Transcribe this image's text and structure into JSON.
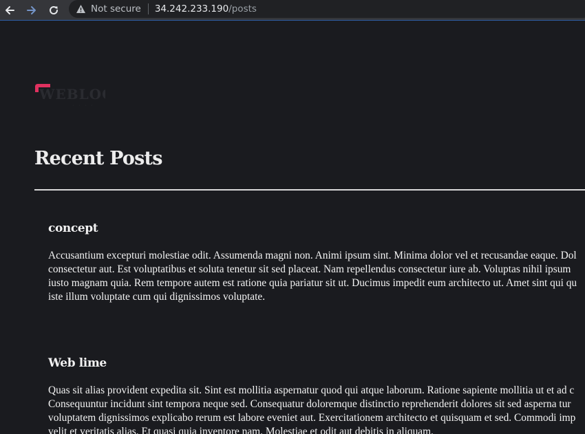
{
  "browser": {
    "security_label": "Not secure",
    "url_host": "34.242.233.190",
    "url_path": "/posts",
    "accent_color": "#2f5fa8"
  },
  "page": {
    "title": "Recent Posts",
    "logo_text": "WEBLOG",
    "logo_accent_color": "#e0315f",
    "background_color": "#1a1b1f"
  },
  "posts": [
    {
      "title": "concept",
      "body_lines": [
        "Accusantium excepturi molestiae odit. Assumenda magni non. Animi ipsum sint. Minima dolor vel et recusandae eaque. Dol",
        "consectetur aut. Est voluptatibus et soluta tenetur sit sed placeat. Nam repellendus consectetur iure ab. Voluptas nihil ipsum",
        "iusto magnam quia. Rem tempore autem est ratione quia pariatur sit ut. Ducimus impedit eum architecto ut. Amet sint qui qu",
        "iste illum voluptate cum qui dignissimos voluptate."
      ]
    },
    {
      "title": "Web lime",
      "body_lines": [
        "Quas sit alias provident expedita sit. Sint est mollitia aspernatur quod qui atque laborum. Ratione sapiente mollitia ut et ad c",
        "Consequuntur incidunt sint tempora neque sed. Consequatur doloremque distinctio reprehenderit dolores sit sed asperna tur",
        "voluptatem dignissimos explicabo rerum est labore eveniet aut. Exercitationem architecto et quisquam et sed. Commodi imp",
        "velit et veritatis alias. Et quasi quia inventore nam. Molestiae et odit aut debitis in aliquam."
      ]
    }
  ]
}
